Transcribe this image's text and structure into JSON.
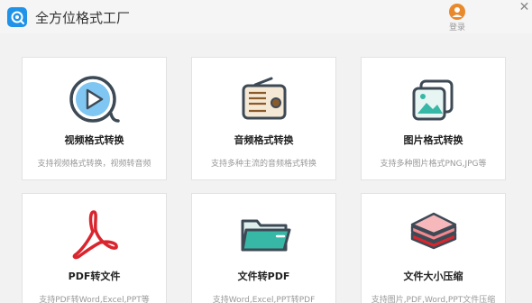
{
  "window": {
    "title": "全方位格式工厂",
    "login_label": "登录",
    "close_glyph": "✕"
  },
  "colors": {
    "accent_blue": "#1f93e8",
    "icon_dark": "#3d4a56",
    "video_blue": "#7fc6f2",
    "audio_brown": "#8a5a2b",
    "image_teal": "#37b8a6",
    "pdf_red": "#d9262e",
    "login_orange": "#e8892b"
  },
  "cards": [
    {
      "icon": "video-play-icon",
      "title": "视频格式转换",
      "desc": "支持视频格式转换，视频转音频"
    },
    {
      "icon": "radio-audio-icon",
      "title": "音频格式转换",
      "desc": "支持多种主流的音频格式转换"
    },
    {
      "icon": "image-gallery-icon",
      "title": "图片格式转换",
      "desc": "支持多种图片格式PNG,JPG等"
    },
    {
      "icon": "pdf-acrobat-icon",
      "title": "PDF转文件",
      "desc": "支持PDF转Word,Excel,PPT等"
    },
    {
      "icon": "folder-icon",
      "title": "文件转PDF",
      "desc": "支持Word,Excel,PPT转PDF"
    },
    {
      "icon": "layers-compress-icon",
      "title": "文件大小压缩",
      "desc": "支持图片,PDF,Word,PPT文件压缩"
    }
  ]
}
